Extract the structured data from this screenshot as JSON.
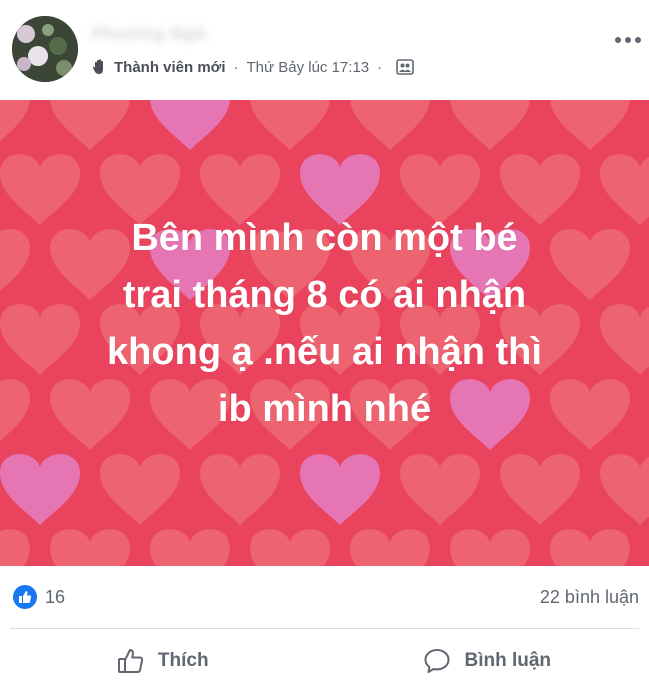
{
  "post": {
    "author_name": "Phương Ngô",
    "member_badge": "Thành viên mới",
    "separator": "·",
    "timestamp": "Thứ Bảy lúc 17:13",
    "separator2": "·",
    "audience_icon": "group-icon",
    "content_lines": [
      "Bên mình còn một bé",
      "trai tháng 8 có ai nhận",
      "khong ạ .nếu ai nhận thì",
      "ib mình nhé"
    ],
    "background_colors": {
      "base": "#e9435e",
      "heart_light": "#ef6d77",
      "heart_pink": "#e57bbd"
    }
  },
  "reactions": {
    "like_count": "16",
    "comment_count": "22 bình luận"
  },
  "actions": {
    "like_label": "Thích",
    "comment_label": "Bình luận"
  }
}
